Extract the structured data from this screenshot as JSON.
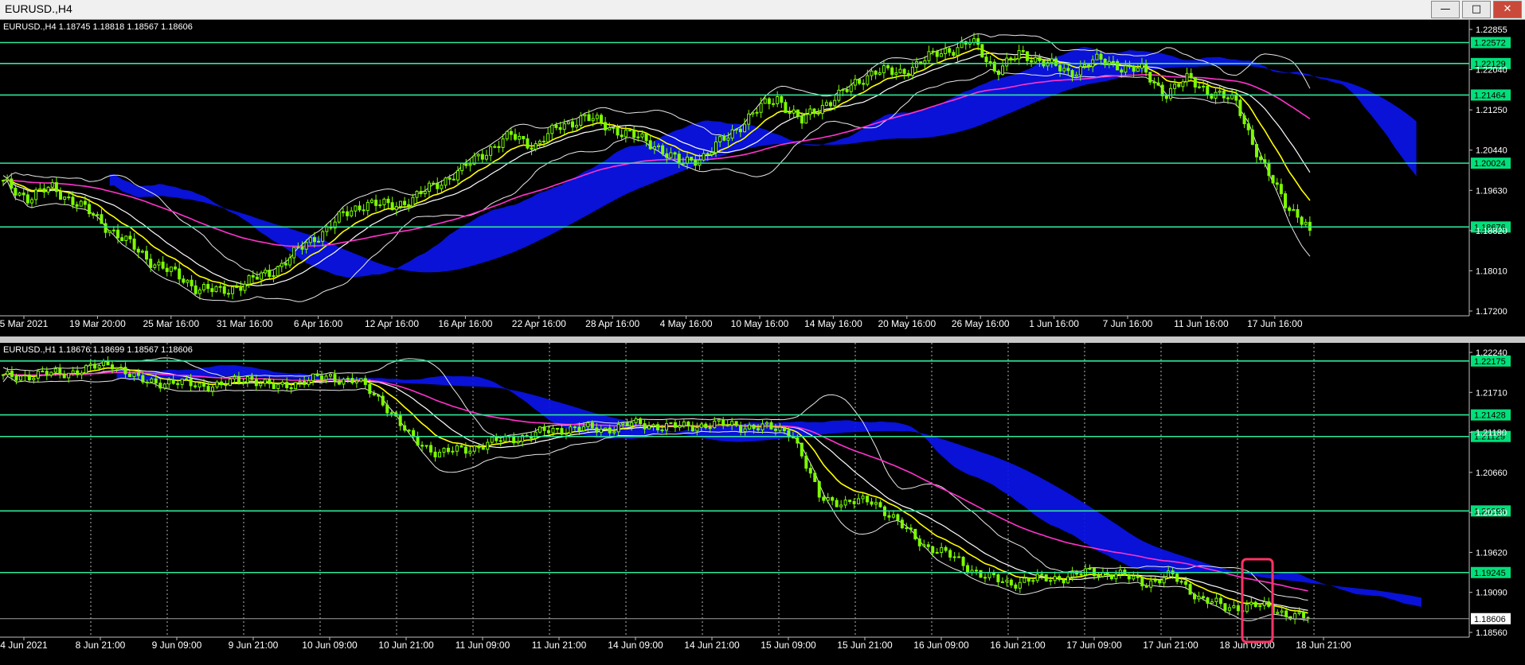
{
  "window": {
    "title": "EURUSD.,H4",
    "buttons": [
      "minimize",
      "maximize",
      "close"
    ]
  },
  "top_pane": {
    "header": "EURUSD.,H4  1.18745 1.18818 1.18567 1.18606",
    "price_ticks": [
      "1.22855",
      "1.22040",
      "1.21250",
      "1.20440",
      "1.19630",
      "1.18820",
      "1.18010",
      "1.17200"
    ],
    "levels": [
      {
        "price": 1.22572,
        "label": "1.22572"
      },
      {
        "price": 1.22129,
        "label": "1.22129"
      },
      {
        "price": 1.21464,
        "label": "1.21464"
      },
      {
        "price": 1.20024,
        "label": "1.20024"
      },
      {
        "price": 1.18676,
        "label": "1.18676"
      }
    ],
    "time_labels": [
      "5 Mar 2021",
      "19 Mar 20:00",
      "25 Mar 16:00",
      "31 Mar 16:00",
      "6 Apr 16:00",
      "12 Apr 16:00",
      "16 Apr 16:00",
      "22 Apr 16:00",
      "28 Apr 16:00",
      "4 May 16:00",
      "10 May 16:00",
      "14 May 16:00",
      "20 May 16:00",
      "26 May 16:00",
      "1 Jun 16:00",
      "7 Jun 16:00",
      "11 Jun 16:00",
      "17 Jun 16:00"
    ]
  },
  "bottom_pane": {
    "header": "EURUSD.,H1  1.18676 1.18699 1.18567 1.18606",
    "price_ticks": [
      "1.22240",
      "1.21710",
      "1.21180",
      "1.20660",
      "1.20130",
      "1.19620",
      "1.19090",
      "1.18560"
    ],
    "levels": [
      {
        "price": 1.22175,
        "label": "1.22175"
      },
      {
        "price": 1.21428,
        "label": "1.21428"
      },
      {
        "price": 1.21129,
        "label": "1.21129"
      },
      {
        "price": 1.20098,
        "label": "1.20098"
      },
      {
        "price": 1.19245,
        "label": "1.19245"
      }
    ],
    "current_price": {
      "price": 1.18606,
      "label": "1.18606"
    },
    "time_labels": [
      "4 Jun 2021",
      "8 Jun 21:00",
      "9 Jun 09:00",
      "9 Jun 21:00",
      "10 Jun 09:00",
      "10 Jun 21:00",
      "11 Jun 09:00",
      "11 Jun 21:00",
      "14 Jun 09:00",
      "14 Jun 21:00",
      "15 Jun 09:00",
      "15 Jun 21:00",
      "16 Jun 09:00",
      "16 Jun 21:00",
      "17 Jun 09:00",
      "17 Jun 21:00",
      "18 Jun 09:00",
      "18 Jun 21:00"
    ]
  },
  "colors": {
    "candle": "#7cfc00",
    "level": "#2ee89a",
    "level_label_bg": "#00e07a",
    "ma_fast": "#ffff00",
    "ma_slow": "#ff33cc",
    "cloud": "#0a14e8",
    "bands": "#e8e8e8",
    "ma_mid": "#ffffff",
    "highlight": "#ff3366",
    "axis_text": "#ffffff",
    "grid": "#ffffff"
  },
  "chart_data": [
    {
      "type": "candlestick",
      "symbol": "EURUSD.",
      "timeframe": "H4",
      "ylim": [
        1.168,
        1.2295
      ],
      "ohlc_last": {
        "open": 1.18745,
        "high": 1.18818,
        "low": 1.18567,
        "close": 1.18606
      },
      "close_path": [
        1.196,
        1.193,
        1.195,
        1.192,
        1.188,
        1.184,
        1.18,
        1.177,
        1.174,
        1.173,
        1.175,
        1.177,
        1.181,
        1.185,
        1.189,
        1.192,
        1.191,
        1.193,
        1.196,
        1.199,
        1.203,
        1.206,
        1.204,
        1.208,
        1.21,
        1.208,
        1.206,
        1.204,
        1.2,
        1.202,
        1.206,
        1.211,
        1.214,
        1.209,
        1.213,
        1.216,
        1.22,
        1.219,
        1.222,
        1.224,
        1.226,
        1.22,
        1.223,
        1.222,
        1.219,
        1.222,
        1.221,
        1.22,
        1.215,
        1.218,
        1.215,
        1.213,
        1.2,
        1.192,
        1.1861
      ]
    },
    {
      "type": "candlestick",
      "symbol": "EURUSD.",
      "timeframe": "H1",
      "ylim": [
        1.1835,
        1.2236
      ],
      "ohlc_last": {
        "open": 1.18676,
        "high": 1.18699,
        "low": 1.18567,
        "close": 1.18606
      },
      "close_path": [
        1.2195,
        1.2198,
        1.22,
        1.2205,
        1.2215,
        1.219,
        1.2188,
        1.2185,
        1.2183,
        1.2195,
        1.218,
        1.219,
        1.2195,
        1.219,
        1.216,
        1.211,
        1.209,
        1.2095,
        1.2105,
        1.2112,
        1.212,
        1.2125,
        1.2122,
        1.213,
        1.2128,
        1.2126,
        1.213,
        1.2128,
        1.2125,
        1.212,
        1.203,
        1.202,
        1.2025,
        1.199,
        1.196,
        1.1945,
        1.192,
        1.191,
        1.1915,
        1.1918,
        1.1925,
        1.1922,
        1.191,
        1.192,
        1.189,
        1.1875,
        1.188,
        1.187,
        1.1861
      ]
    }
  ]
}
